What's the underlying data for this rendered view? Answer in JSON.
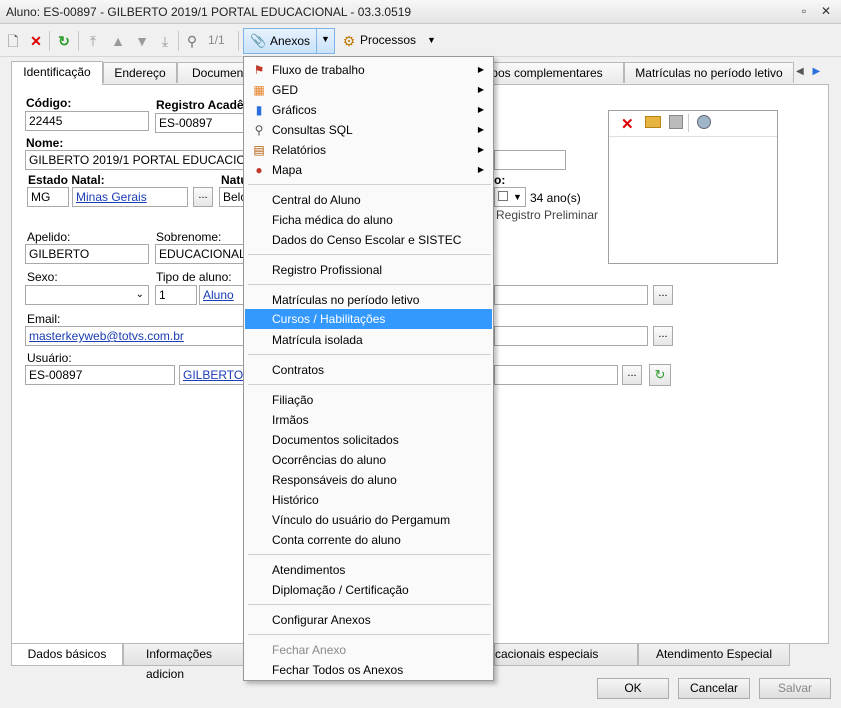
{
  "window": {
    "title": "Aluno: ES-00897 - GILBERTO 2019/1 PORTAL EDUCACIONAL - 03.3.0519"
  },
  "toolbar": {
    "page_counter": "1/1",
    "anexos_label": "Anexos",
    "processos_label": "Processos"
  },
  "tabs": [
    "Identificação",
    "Endereço",
    "Document",
    "pos complementares",
    "Matrículas no período letivo"
  ],
  "form": {
    "codigo_label": "Código:",
    "codigo_value": "22445",
    "registro_label": "Registro Acadê",
    "registro_value": "ES-00897",
    "nome_label": "Nome:",
    "nome_value": "GILBERTO 2019/1 PORTAL EDUCACIONAL",
    "estado_label": "Estado Natal:",
    "estado_value": "MG",
    "estado_link": "Minas Gerais",
    "natu_label": "Natu",
    "natu_value": "Belo",
    "data_label": "o:",
    "age_text": "34 ano(s)",
    "registro_preliminar": "Registro Preliminar",
    "apelido_label": "Apelido:",
    "apelido_value": "GILBERTO",
    "sobrenome_label": "Sobrenome:",
    "sobrenome_value": "EDUCACIONAL",
    "sexo_label": "Sexo:",
    "tipo_label": "Tipo de aluno:",
    "tipo_value": "1",
    "tipo_link": "Aluno",
    "email_label": "Email:",
    "email_value": "masterkeyweb@totvs.com.br",
    "usuario_label": "Usuário:",
    "usuario_value": "ES-00897",
    "usuario_link": "GILBERTO 2"
  },
  "bottom_tabs": [
    "Dados básicos",
    "Informações adicion",
    "cacionais especiais",
    "Atendimento Especial"
  ],
  "buttons": {
    "ok": "OK",
    "cancel": "Cancelar",
    "save": "Salvar"
  },
  "menu": {
    "submenu_items": [
      {
        "label": "Fluxo de trabalho",
        "icon": "workflow-icon"
      },
      {
        "label": "GED",
        "icon": "ged-icon"
      },
      {
        "label": "Gráficos",
        "icon": "chart-icon"
      },
      {
        "label": "Consultas SQL",
        "icon": "sql-query-icon"
      },
      {
        "label": "Relatórios",
        "icon": "report-icon"
      },
      {
        "label": "Mapa",
        "icon": "map-pin-icon"
      }
    ],
    "group2": [
      "Central do Aluno",
      "Ficha médica do aluno",
      "Dados do Censo Escolar e SISTEC"
    ],
    "group3": [
      "Registro Profissional"
    ],
    "group4": [
      "Matrículas no período letivo",
      "Cursos / Habilitações",
      "Matrícula isolada"
    ],
    "group5": [
      "Contratos"
    ],
    "group6": [
      "Filiação",
      "Irmãos",
      "Documentos solicitados",
      "Ocorrências do aluno",
      "Responsáveis do aluno",
      "Histórico",
      "Vínculo do usuário do Pergamum",
      "Conta corrente do aluno"
    ],
    "group7": [
      "Atendimentos",
      "Diplomação / Certificação"
    ],
    "group8": [
      "Configurar Anexos"
    ],
    "group9": [
      "Fechar Anexo",
      "Fechar Todos os Anexos"
    ],
    "highlighted": "Cursos / Habilitações"
  }
}
